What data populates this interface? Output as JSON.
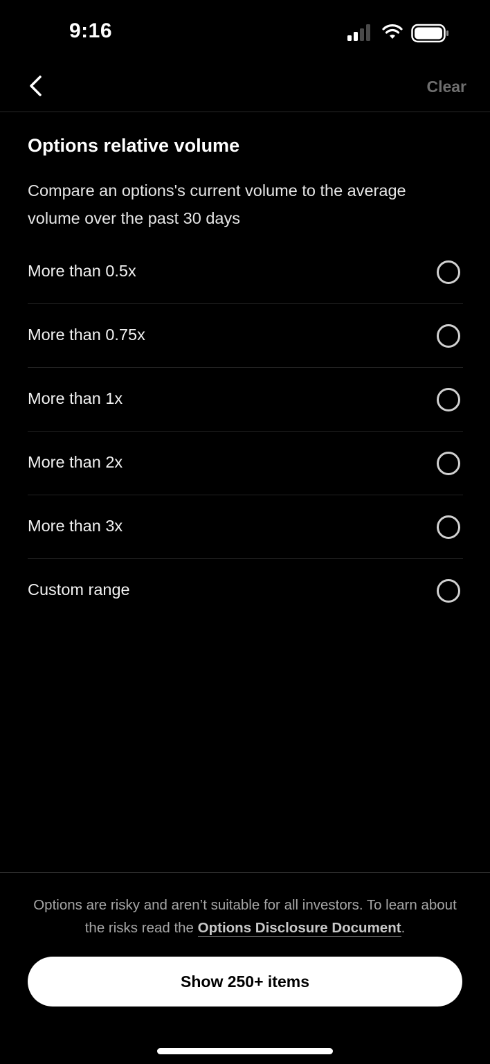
{
  "status_bar": {
    "time": "9:16",
    "icons": [
      "signal-icon",
      "wifi-icon",
      "battery-icon"
    ]
  },
  "nav": {
    "back_icon": "chevron-left-icon",
    "clear_label": "Clear"
  },
  "content": {
    "title": "Options relative volume",
    "description": "Compare an options's current volume to the average volume over the past 30 days",
    "options": [
      {
        "label": "More than 0.5x",
        "selected": false
      },
      {
        "label": "More than 0.75x",
        "selected": false
      },
      {
        "label": "More than 1x",
        "selected": false
      },
      {
        "label": "More than 2x",
        "selected": false
      },
      {
        "label": "More than 3x",
        "selected": false
      },
      {
        "label": "Custom range",
        "selected": false
      }
    ]
  },
  "footer": {
    "disclaimer_prefix": "Options are risky and aren’t suitable for all investors. To learn about the risks read the ",
    "disclosure_link": "Options Disclosure Document",
    "disclaimer_suffix": ".",
    "show_button_label": "Show 250+ items"
  },
  "colors": {
    "background": "#000000",
    "text": "#ffffff",
    "muted": "#6f6f6f",
    "button_bg": "#ffffff"
  }
}
